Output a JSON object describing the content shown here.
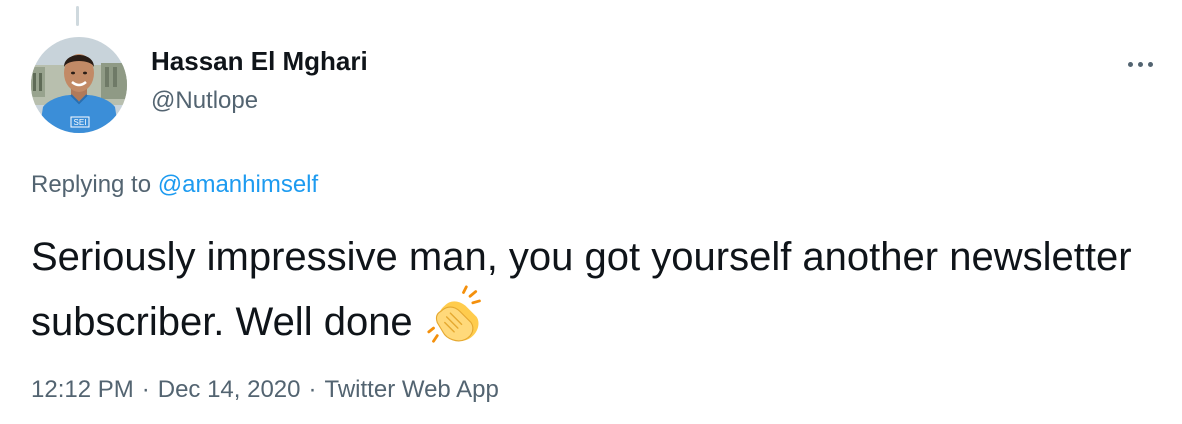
{
  "tweet": {
    "author": {
      "display_name": "Hassan El Mghari",
      "handle": "@Nutlope",
      "avatar_shirt_text": "SEI"
    },
    "reply": {
      "prefix": "Replying to",
      "mention": "@amanhimself"
    },
    "text": "Seriously impressive man, you got yourself another newsletter subscriber. Well done",
    "emoji": "clapping-hands",
    "meta": {
      "time": "12:12 PM",
      "separator": "·",
      "date": "Dec 14, 2020",
      "source": "Twitter Web App"
    },
    "more_icon": "more-horizontal-icon"
  },
  "colors": {
    "text_primary": "#0f1419",
    "text_secondary": "#536471",
    "link": "#1d9bf0"
  }
}
